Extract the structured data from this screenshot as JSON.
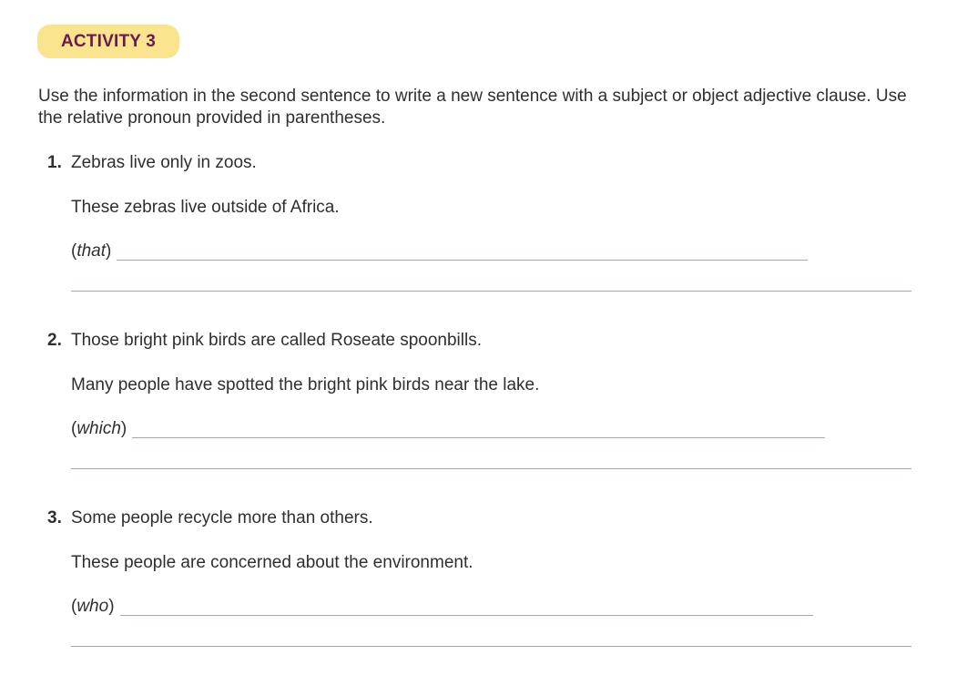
{
  "activity": {
    "label": "ACTIVITY 3"
  },
  "instructions": "Use the information in the second sentence to write a new sentence with a subject or object adjective clause. Use the relative pronoun provided in parentheses.",
  "items": [
    {
      "number": "1.",
      "sentence": "Zebras live only in zoos.",
      "second": "These zebras live outside of Africa.",
      "pronoun": "that"
    },
    {
      "number": "2.",
      "sentence": "Those bright pink birds are called Roseate spoonbills.",
      "second": "Many people have spotted the bright pink birds near the lake.",
      "pronoun": "which"
    },
    {
      "number": "3.",
      "sentence": "Some people recycle more than others.",
      "second": "These people are concerned about the environment.",
      "pronoun": "who"
    }
  ],
  "colors": {
    "badge_bg": "#fbe48e",
    "badge_text": "#6a1a4c",
    "rule": "#a3ad99"
  }
}
